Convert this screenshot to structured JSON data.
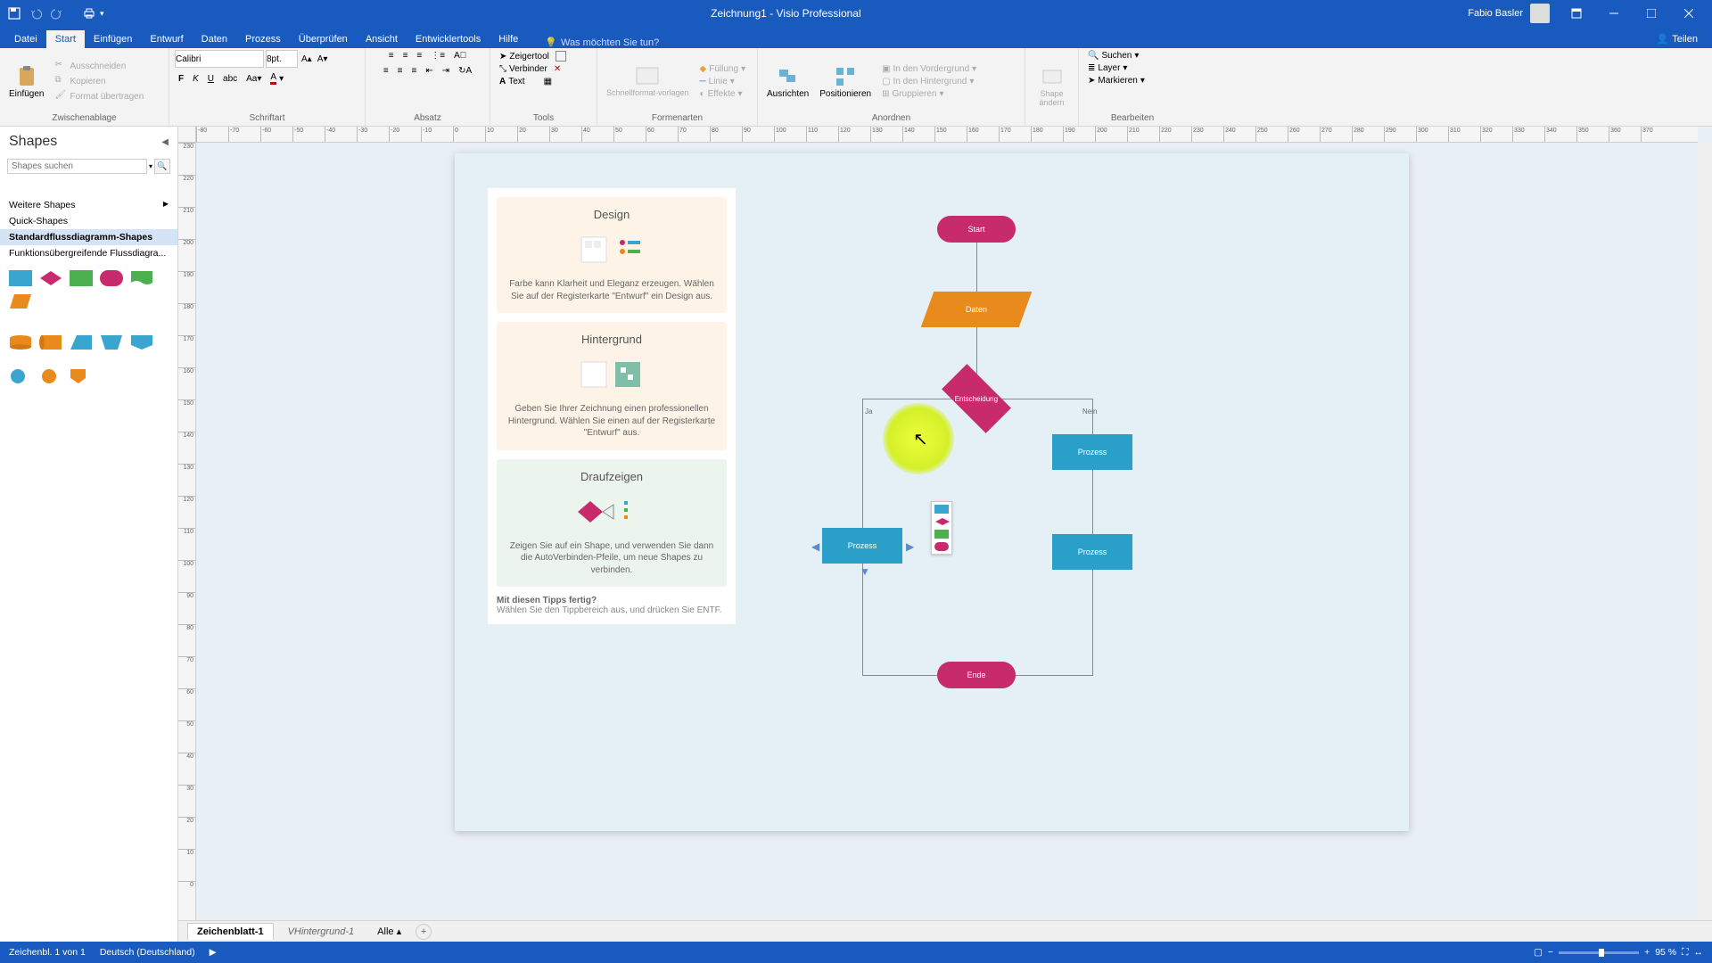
{
  "title": "Zeichnung1 - Visio Professional",
  "user": "Fabio Basler",
  "tabs": [
    "Datei",
    "Start",
    "Einfügen",
    "Entwurf",
    "Daten",
    "Prozess",
    "Überprüfen",
    "Ansicht",
    "Entwicklertools",
    "Hilfe"
  ],
  "tellme": "Was möchten Sie tun?",
  "share": "Teilen",
  "ribbon": {
    "clipboard": {
      "label": "Zwischenablage",
      "paste": "Einfügen",
      "cut": "Ausschneiden",
      "copy": "Kopieren",
      "format": "Format übertragen"
    },
    "font": {
      "label": "Schriftart",
      "name": "Calibri",
      "size": "8pt."
    },
    "para": {
      "label": "Absatz"
    },
    "tools": {
      "label": "Tools",
      "pointer": "Zeigertool",
      "connector": "Verbinder",
      "text": "Text"
    },
    "shapestyle": {
      "label": "Formenarten",
      "quick": "Schnellformat-vorlagen",
      "fill": "Füllung",
      "line": "Linie",
      "effects": "Effekte"
    },
    "arrange": {
      "label": "Anordnen",
      "align": "Ausrichten",
      "position": "Positionieren",
      "front": "In den Vordergrund",
      "back": "In den Hintergrund",
      "group": "Gruppieren"
    },
    "shape": {
      "label": "",
      "change": "Shape ändern"
    },
    "edit": {
      "label": "Bearbeiten",
      "find": "Suchen",
      "layer": "Layer",
      "select": "Markieren"
    }
  },
  "shapesPanel": {
    "title": "Shapes",
    "search": "Shapes suchen",
    "more": "Weitere Shapes",
    "quick": "Quick-Shapes",
    "standard": "Standardflussdiagramm-Shapes",
    "cross": "Funktionsübergreifende Flussdiagra..."
  },
  "tips": {
    "design": {
      "title": "Design",
      "text": "Farbe kann Klarheit und Eleganz erzeugen. Wählen Sie auf der Registerkarte \"Entwurf\" ein Design aus."
    },
    "background": {
      "title": "Hintergrund",
      "text": "Geben Sie Ihrer Zeichnung einen professionellen Hintergrund. Wählen Sie einen auf der Registerkarte \"Entwurf\" aus."
    },
    "hover": {
      "title": "Draufzeigen",
      "text": "Zeigen Sie auf ein Shape, und verwenden Sie dann die AutoVerbinden-Pfeile, um neue Shapes zu verbinden."
    },
    "footer1": "Mit diesen Tipps fertig?",
    "footer2": "Wählen Sie den Tippbereich aus, und drücken Sie ENTF."
  },
  "flow": {
    "start": "Start",
    "data": "Daten",
    "decision": "Entscheidung",
    "process": "Prozess",
    "end": "Ende",
    "yes": "Ja",
    "no": "Nein"
  },
  "sheets": {
    "s1": "Zeichenblatt-1",
    "s2": "VHintergrund-1",
    "all": "Alle"
  },
  "status": {
    "page": "Zeichenbl. 1 von 1",
    "lang": "Deutsch (Deutschland)",
    "zoom": "95 %"
  },
  "rulerH": [
    "-80",
    "-70",
    "-60",
    "-50",
    "-40",
    "-30",
    "-20",
    "-10",
    "0",
    "10",
    "20",
    "30",
    "40",
    "50",
    "60",
    "70",
    "80",
    "90",
    "100",
    "110",
    "120",
    "130",
    "140",
    "150",
    "160",
    "170",
    "180",
    "190",
    "200",
    "210",
    "220",
    "230",
    "240",
    "250",
    "260",
    "270",
    "280",
    "290",
    "300",
    "310",
    "320",
    "330",
    "340",
    "350",
    "360",
    "370"
  ],
  "rulerV": [
    "230",
    "220",
    "210",
    "200",
    "190",
    "180",
    "170",
    "160",
    "150",
    "140",
    "130",
    "120",
    "110",
    "100",
    "90",
    "80",
    "70",
    "60",
    "50",
    "40",
    "30",
    "20",
    "10",
    "0"
  ]
}
